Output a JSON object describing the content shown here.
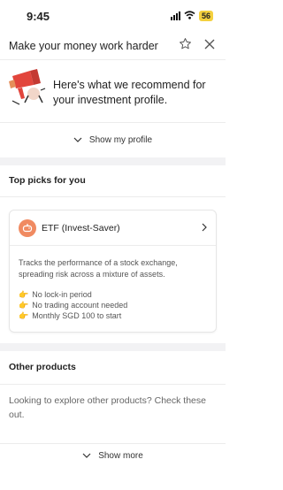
{
  "status": {
    "time": "9:45",
    "battery": "56"
  },
  "header": {
    "title": "Make your money work harder",
    "star_icon": "star-icon",
    "close_icon": "close-icon"
  },
  "recommendation": {
    "text": "Here's what we recommend for your investment profile."
  },
  "profile": {
    "label": "Show my profile"
  },
  "top_picks": {
    "title": "Top picks for you",
    "card": {
      "title": "ETF (Invest-Saver)",
      "description": "Tracks the performance of a stock exchange, spreading risk across a mixture of assets.",
      "bullets": [
        "No lock-in period",
        "No trading account needed",
        "Monthly SGD 100 to start"
      ]
    }
  },
  "other": {
    "title": "Other products",
    "description": "Looking to explore other products? Check these out.",
    "more_label": "Show more"
  },
  "colors": {
    "accent": "#f08a61",
    "battery": "#f4d03f",
    "divider": "#ececec"
  }
}
